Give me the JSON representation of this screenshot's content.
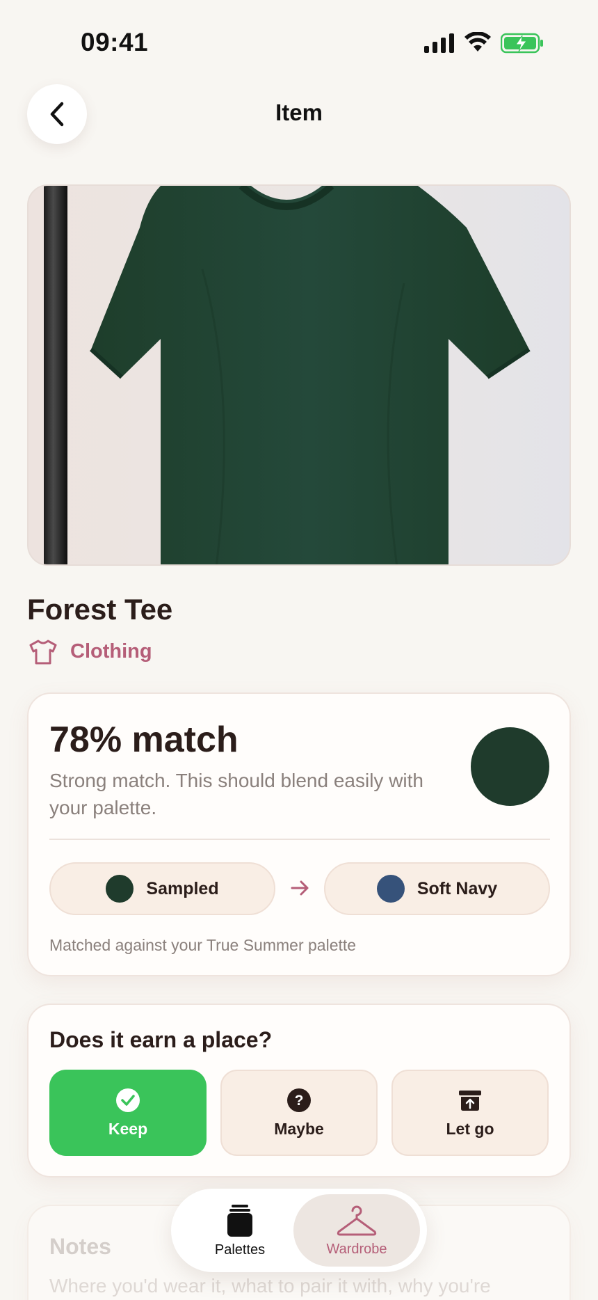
{
  "status_bar": {
    "time": "09:41"
  },
  "header": {
    "title": "Item"
  },
  "item": {
    "name": "Forest Tee",
    "category": "Clothing"
  },
  "match": {
    "percent_label": "78% match",
    "description": "Strong match. This should blend easily with your palette.",
    "swatch_color": "#1f3b2c",
    "sampled": {
      "label": "Sampled",
      "color": "#1f3b2c"
    },
    "target": {
      "label": "Soft Navy",
      "color": "#36527a"
    },
    "palette_note": "Matched against your True Summer palette"
  },
  "decision": {
    "title": "Does it earn a place?",
    "options": [
      {
        "label": "Keep",
        "icon": "check-circle-icon",
        "selected": true
      },
      {
        "label": "Maybe",
        "icon": "question-circle-icon",
        "selected": false
      },
      {
        "label": "Let go",
        "icon": "archive-box-icon",
        "selected": false
      }
    ]
  },
  "notes": {
    "title": "Notes",
    "placeholder": "Where you'd wear it, what to pair it with, why you're unsure"
  },
  "tabs": [
    {
      "label": "Palettes",
      "icon": "jar-icon",
      "active": false
    },
    {
      "label": "Wardrobe",
      "icon": "hanger-icon",
      "active": true
    }
  ],
  "colors": {
    "accent": "#b55e78",
    "keep_green": "#3ac45a",
    "background": "#f8f6f2"
  }
}
